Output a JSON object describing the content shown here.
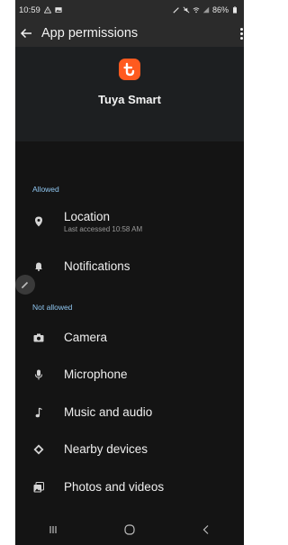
{
  "status": {
    "time": "10:59",
    "battery": "86%"
  },
  "appbar": {
    "title": "App permissions"
  },
  "app": {
    "name": "Tuya Smart",
    "logo_color": "#ff5a1f"
  },
  "sections": {
    "allowed": {
      "label": "Allowed",
      "items": [
        {
          "label": "Location",
          "sub": "Last accessed 10:58 AM",
          "icon": "location-pin-icon"
        },
        {
          "label": "Notifications",
          "icon": "bell-icon"
        }
      ]
    },
    "not_allowed": {
      "label": "Not allowed",
      "items": [
        {
          "label": "Camera",
          "icon": "camera-icon"
        },
        {
          "label": "Microphone",
          "icon": "microphone-icon"
        },
        {
          "label": "Music and audio",
          "icon": "music-note-icon"
        },
        {
          "label": "Nearby devices",
          "icon": "nearby-devices-icon"
        },
        {
          "label": "Photos and videos",
          "icon": "photos-icon"
        }
      ]
    }
  },
  "colors": {
    "accent_label": "#8fc6f0",
    "background": "#141414",
    "header": "#1d1f21"
  }
}
